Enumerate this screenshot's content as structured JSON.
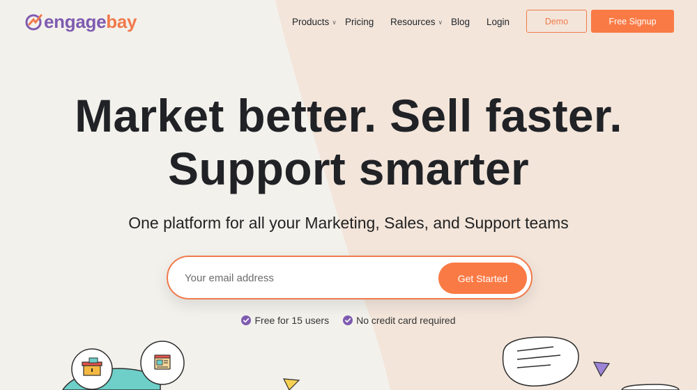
{
  "brand": {
    "part1": "engage",
    "part2": "bay",
    "colors": {
      "purple": "#7e5bb0",
      "orange": "#f07a4a"
    }
  },
  "nav": {
    "items": [
      {
        "label": "Products",
        "has_dropdown": true
      },
      {
        "label": "Pricing",
        "has_dropdown": false
      },
      {
        "label": "Resources",
        "has_dropdown": true
      },
      {
        "label": "Blog",
        "has_dropdown": false
      },
      {
        "label": "Login",
        "has_dropdown": false
      }
    ],
    "demo_label": "Demo",
    "signup_label": "Free Signup"
  },
  "hero": {
    "line1": "Market better. Sell faster.",
    "line2": "Support smarter",
    "subtitle": "One platform for all your Marketing, Sales, and Support teams",
    "email_placeholder": "Your email address",
    "cta_label": "Get Started",
    "perks": [
      "Free for 15 users",
      "No credit card required"
    ]
  },
  "icons": {
    "logo": "engagebay-logo-mark",
    "dropdown": "chevron-down-icon",
    "perk": "check-circle-icon",
    "illustrations": [
      "shopping-basket-icon",
      "browser-window-icon",
      "chat-bubble-icon",
      "triangle-shape-icon"
    ]
  }
}
